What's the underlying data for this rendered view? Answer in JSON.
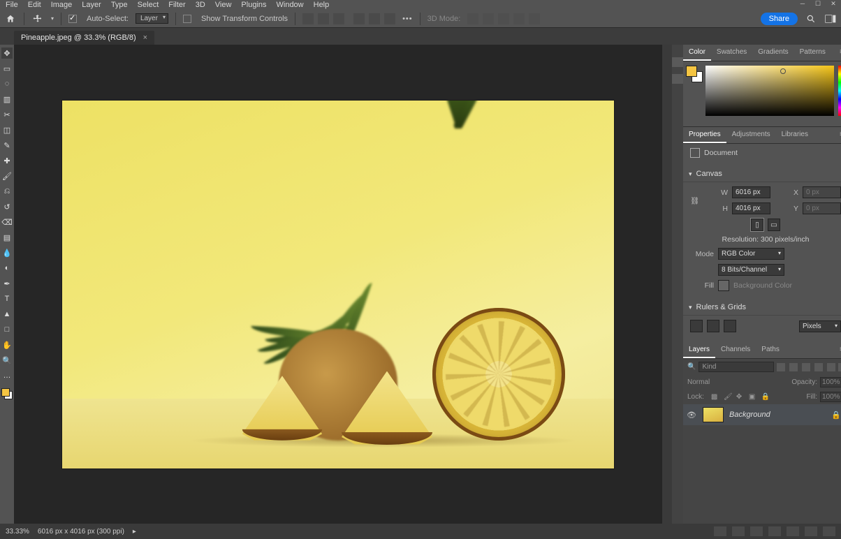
{
  "menu": [
    "File",
    "Edit",
    "Image",
    "Layer",
    "Type",
    "Select",
    "Filter",
    "3D",
    "View",
    "Plugins",
    "Window",
    "Help"
  ],
  "options": {
    "auto_select_label": "Auto-Select:",
    "auto_select_target": "Layer",
    "show_transform_label": "Show Transform Controls",
    "mode_3d": "3D Mode:",
    "share": "Share"
  },
  "tab": {
    "title": "Pineapple.jpeg @ 33.3% (RGB/8)"
  },
  "panels": {
    "color_tabs": [
      "Color",
      "Swatches",
      "Gradients",
      "Patterns"
    ],
    "prop_tabs": [
      "Properties",
      "Adjustments",
      "Libraries"
    ],
    "layer_tabs": [
      "Layers",
      "Channels",
      "Paths"
    ]
  },
  "properties": {
    "doc_type": "Document",
    "canvas_header": "Canvas",
    "w_label": "W",
    "w_value": "6016 px",
    "h_label": "H",
    "h_value": "4016 px",
    "x_label": "X",
    "x_value": "0 px",
    "y_label": "Y",
    "y_value": "0 px",
    "resolution": "Resolution: 300 pixels/inch",
    "mode_label": "Mode",
    "mode_value": "RGB Color",
    "depth_value": "8 Bits/Channel",
    "fill_label": "Fill",
    "fill_name": "Background Color",
    "rg_header": "Rulers & Grids",
    "units": "Pixels"
  },
  "layers": {
    "kind_label": "Kind",
    "blend": "Normal",
    "opacity_label": "Opacity:",
    "opacity_value": "100%",
    "lock_label": "Lock:",
    "fill_label": "Fill:",
    "fill_value": "100%",
    "bg_name": "Background"
  },
  "status": {
    "zoom": "33.33%",
    "dims": "6016 px x 4016 px (300 ppi)"
  },
  "colors": {
    "foreground": "#f5c542",
    "background": "#ffffff"
  }
}
